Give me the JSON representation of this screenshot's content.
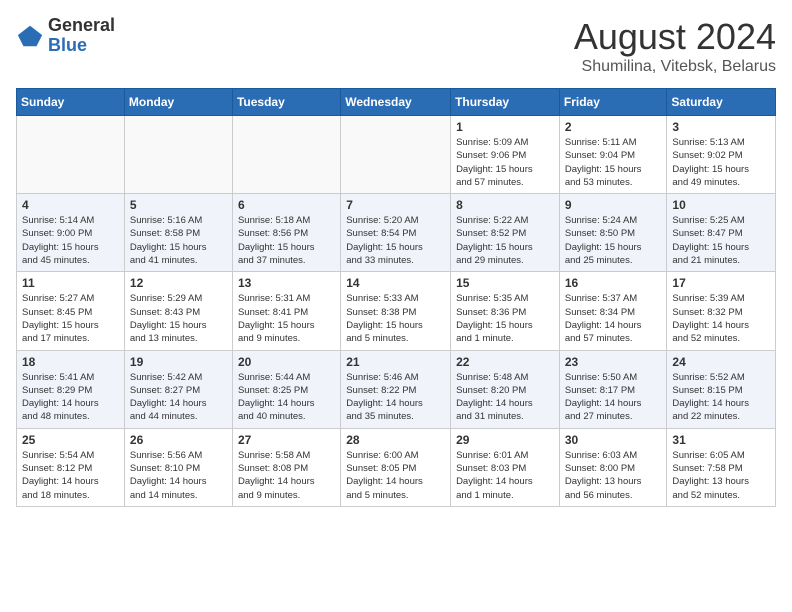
{
  "logo": {
    "general": "General",
    "blue": "Blue"
  },
  "title": "August 2024",
  "location": "Shumilina, Vitebsk, Belarus",
  "days_of_week": [
    "Sunday",
    "Monday",
    "Tuesday",
    "Wednesday",
    "Thursday",
    "Friday",
    "Saturday"
  ],
  "weeks": [
    [
      {
        "day": "",
        "info": ""
      },
      {
        "day": "",
        "info": ""
      },
      {
        "day": "",
        "info": ""
      },
      {
        "day": "",
        "info": ""
      },
      {
        "day": "1",
        "info": "Sunrise: 5:09 AM\nSunset: 9:06 PM\nDaylight: 15 hours\nand 57 minutes."
      },
      {
        "day": "2",
        "info": "Sunrise: 5:11 AM\nSunset: 9:04 PM\nDaylight: 15 hours\nand 53 minutes."
      },
      {
        "day": "3",
        "info": "Sunrise: 5:13 AM\nSunset: 9:02 PM\nDaylight: 15 hours\nand 49 minutes."
      }
    ],
    [
      {
        "day": "4",
        "info": "Sunrise: 5:14 AM\nSunset: 9:00 PM\nDaylight: 15 hours\nand 45 minutes."
      },
      {
        "day": "5",
        "info": "Sunrise: 5:16 AM\nSunset: 8:58 PM\nDaylight: 15 hours\nand 41 minutes."
      },
      {
        "day": "6",
        "info": "Sunrise: 5:18 AM\nSunset: 8:56 PM\nDaylight: 15 hours\nand 37 minutes."
      },
      {
        "day": "7",
        "info": "Sunrise: 5:20 AM\nSunset: 8:54 PM\nDaylight: 15 hours\nand 33 minutes."
      },
      {
        "day": "8",
        "info": "Sunrise: 5:22 AM\nSunset: 8:52 PM\nDaylight: 15 hours\nand 29 minutes."
      },
      {
        "day": "9",
        "info": "Sunrise: 5:24 AM\nSunset: 8:50 PM\nDaylight: 15 hours\nand 25 minutes."
      },
      {
        "day": "10",
        "info": "Sunrise: 5:25 AM\nSunset: 8:47 PM\nDaylight: 15 hours\nand 21 minutes."
      }
    ],
    [
      {
        "day": "11",
        "info": "Sunrise: 5:27 AM\nSunset: 8:45 PM\nDaylight: 15 hours\nand 17 minutes."
      },
      {
        "day": "12",
        "info": "Sunrise: 5:29 AM\nSunset: 8:43 PM\nDaylight: 15 hours\nand 13 minutes."
      },
      {
        "day": "13",
        "info": "Sunrise: 5:31 AM\nSunset: 8:41 PM\nDaylight: 15 hours\nand 9 minutes."
      },
      {
        "day": "14",
        "info": "Sunrise: 5:33 AM\nSunset: 8:38 PM\nDaylight: 15 hours\nand 5 minutes."
      },
      {
        "day": "15",
        "info": "Sunrise: 5:35 AM\nSunset: 8:36 PM\nDaylight: 15 hours\nand 1 minute."
      },
      {
        "day": "16",
        "info": "Sunrise: 5:37 AM\nSunset: 8:34 PM\nDaylight: 14 hours\nand 57 minutes."
      },
      {
        "day": "17",
        "info": "Sunrise: 5:39 AM\nSunset: 8:32 PM\nDaylight: 14 hours\nand 52 minutes."
      }
    ],
    [
      {
        "day": "18",
        "info": "Sunrise: 5:41 AM\nSunset: 8:29 PM\nDaylight: 14 hours\nand 48 minutes."
      },
      {
        "day": "19",
        "info": "Sunrise: 5:42 AM\nSunset: 8:27 PM\nDaylight: 14 hours\nand 44 minutes."
      },
      {
        "day": "20",
        "info": "Sunrise: 5:44 AM\nSunset: 8:25 PM\nDaylight: 14 hours\nand 40 minutes."
      },
      {
        "day": "21",
        "info": "Sunrise: 5:46 AM\nSunset: 8:22 PM\nDaylight: 14 hours\nand 35 minutes."
      },
      {
        "day": "22",
        "info": "Sunrise: 5:48 AM\nSunset: 8:20 PM\nDaylight: 14 hours\nand 31 minutes."
      },
      {
        "day": "23",
        "info": "Sunrise: 5:50 AM\nSunset: 8:17 PM\nDaylight: 14 hours\nand 27 minutes."
      },
      {
        "day": "24",
        "info": "Sunrise: 5:52 AM\nSunset: 8:15 PM\nDaylight: 14 hours\nand 22 minutes."
      }
    ],
    [
      {
        "day": "25",
        "info": "Sunrise: 5:54 AM\nSunset: 8:12 PM\nDaylight: 14 hours\nand 18 minutes."
      },
      {
        "day": "26",
        "info": "Sunrise: 5:56 AM\nSunset: 8:10 PM\nDaylight: 14 hours\nand 14 minutes."
      },
      {
        "day": "27",
        "info": "Sunrise: 5:58 AM\nSunset: 8:08 PM\nDaylight: 14 hours\nand 9 minutes."
      },
      {
        "day": "28",
        "info": "Sunrise: 6:00 AM\nSunset: 8:05 PM\nDaylight: 14 hours\nand 5 minutes."
      },
      {
        "day": "29",
        "info": "Sunrise: 6:01 AM\nSunset: 8:03 PM\nDaylight: 14 hours\nand 1 minute."
      },
      {
        "day": "30",
        "info": "Sunrise: 6:03 AM\nSunset: 8:00 PM\nDaylight: 13 hours\nand 56 minutes."
      },
      {
        "day": "31",
        "info": "Sunrise: 6:05 AM\nSunset: 7:58 PM\nDaylight: 13 hours\nand 52 minutes."
      }
    ]
  ]
}
